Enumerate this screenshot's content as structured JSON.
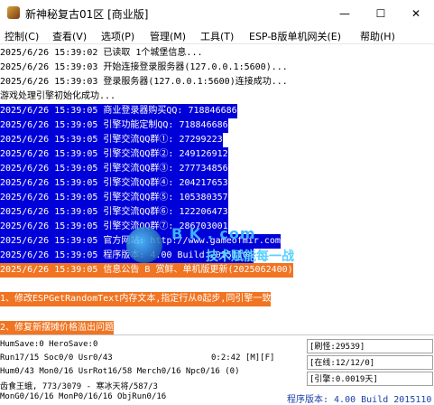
{
  "window": {
    "title": "新神秘复古01区 [商业版]",
    "minimize": "—",
    "maximize": "☐",
    "close": "✕"
  },
  "menu": [
    "控制(C)",
    "查看(V)",
    "选项(P)",
    "管理(M)",
    "工具(T)",
    "ESP-B版单机网关(E)",
    "帮助(H)"
  ],
  "log": [
    {
      "text": "2025/6/26 15:39:02 已读取 1个城堡信息...",
      "style": "normal"
    },
    {
      "text": "2025/6/26 15:39:03 开始连接登录服务器(127.0.0.1:5600)...",
      "style": "normal"
    },
    {
      "text": "2025/6/26 15:39:03 登录服务器(127.0.0.1:5600)连接成功...",
      "style": "normal"
    },
    {
      "text": "游戏处理引擎初始化成功...",
      "style": "normal"
    },
    {
      "text": "2025/6/26 15:39:05 商业登录器购买QQ: 718846686",
      "style": "hl"
    },
    {
      "text": "2025/6/26 15:39:05 引擎功能定制QQ: 718846686",
      "style": "hl"
    },
    {
      "text": "2025/6/26 15:39:05 引擎交流QQ群①: 27299223",
      "style": "hl"
    },
    {
      "text": "2025/6/26 15:39:05 引擎交流QQ群②: 249126912",
      "style": "hl"
    },
    {
      "text": "2025/6/26 15:39:05 引擎交流QQ群③: 277734856",
      "style": "hl"
    },
    {
      "text": "2025/6/26 15:39:05 引擎交流QQ群④: 204217653",
      "style": "hl"
    },
    {
      "text": "2025/6/26 15:39:05 引擎交流QQ群⑤: 105380357",
      "style": "hl"
    },
    {
      "text": "2025/6/26 15:39:05 引擎交流QQ群⑥: 122206473",
      "style": "hl"
    },
    {
      "text": "2025/6/26 15:39:05 引擎交流QQ群⑦: 286703001",
      "style": "hl"
    },
    {
      "text": "2025/6/26 15:39:05 官方网站: http://www.gameofmir.com",
      "style": "hl"
    },
    {
      "text": "2025/6/26 15:39:05 程序版本: 4.00 Build 20151104",
      "style": "hl"
    },
    {
      "text": "2025/6/26 15:39:05 信息公告 B 赏鲜、单机版更新(2025062400)",
      "style": "orange"
    },
    {
      "text": "",
      "style": "blank"
    },
    {
      "text": "1、修改ESPGetRandomText内存文本,指定行从0起步,同引擎一致",
      "style": "orange"
    },
    {
      "text": "",
      "style": "blank"
    },
    {
      "text": "2、修复新摆摊价格溢出问题",
      "style": "orange"
    }
  ],
  "watermark": {
    "domain": "B K . com",
    "slogan": "技术赋能每一战"
  },
  "status": {
    "line1": "HumSave:0 HeroSave:0",
    "line2": "Run17/15 Soc0/0 Usr0/43",
    "line2_right": "0:2:42 [M][F]",
    "line3": "Hum0/43 Mon0/16 UsrRot16/58 Merch0/16 Npc0/16 (0)",
    "line4": "齿食王蛾, 773/3079 - 寒冰天将/587/3",
    "line5": "MonG0/16/16 MonP0/16/16 ObjRun0/16",
    "refresh": "[刷怪:29539]",
    "online": "[在线:12/12/0]",
    "engine": "[引擎:0.0019天]",
    "version": "程序版本: 4.00 Build 2015110"
  }
}
